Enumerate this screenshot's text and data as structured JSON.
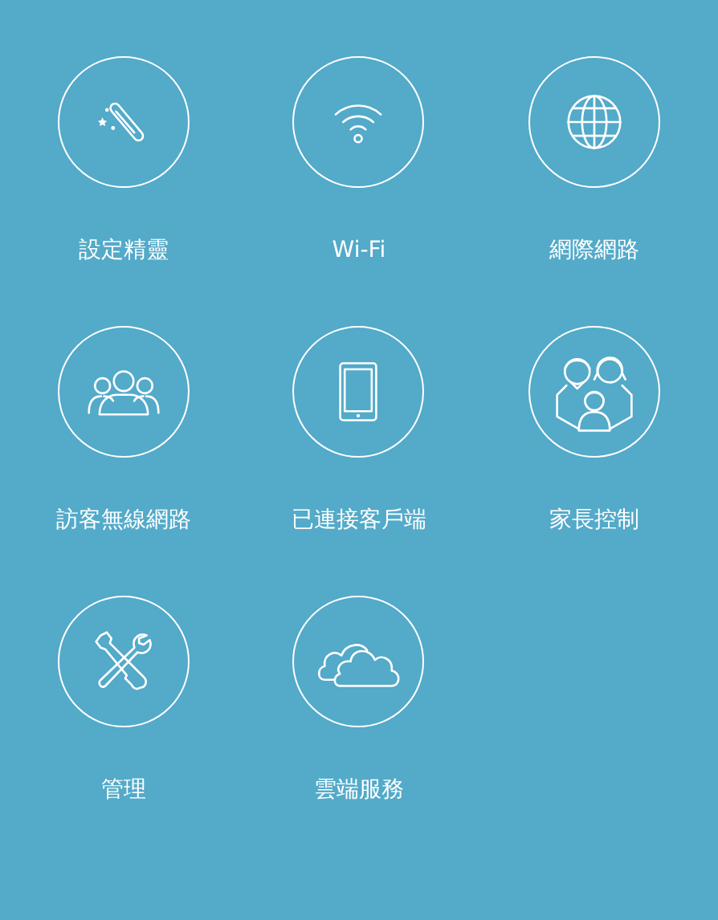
{
  "tiles": [
    {
      "kind": "wizard",
      "label": "設定精靈"
    },
    {
      "kind": "wifi",
      "label": "Wi-Fi"
    },
    {
      "kind": "globe",
      "label": "網際網路"
    },
    {
      "kind": "guests",
      "label": "訪客無線網路"
    },
    {
      "kind": "tablet",
      "label": "已連接客戶端"
    },
    {
      "kind": "family",
      "label": "家長控制"
    },
    {
      "kind": "tools",
      "label": "管理"
    },
    {
      "kind": "cloud",
      "label": "雲端服務"
    }
  ]
}
